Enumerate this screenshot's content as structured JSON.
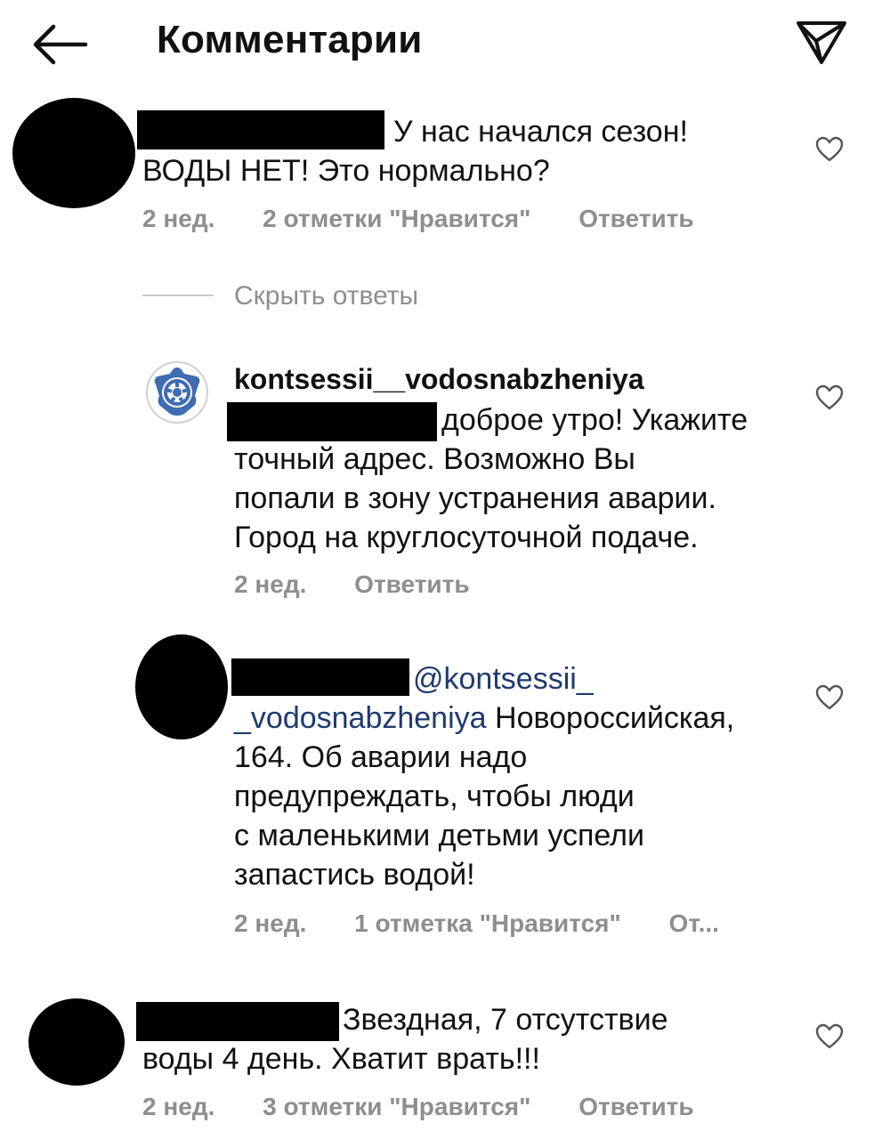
{
  "header": {
    "title": "Комментарии"
  },
  "comments": [
    {
      "text_line1": "У нас начался сезон!",
      "text_line2": "ВОДЫ НЕТ! Это нормально?",
      "time": "2 нед.",
      "likes": "2 отметки \"Нравится\"",
      "reply": "Ответить"
    },
    {
      "text_line1": "Звездная, 7 отсутствие",
      "text_line2": "воды 4 день. Хватит врать!!!",
      "time": "2 нед.",
      "likes": "3 отметки \"Нравится\"",
      "reply": "Ответить"
    }
  ],
  "hide_replies": "Скрыть ответы",
  "replies": [
    {
      "username": "kontsessii__vodosnabzheniya",
      "lines": [
        "доброе утро! Укажите",
        "точный адрес. Возможно Вы",
        "попали в зону устранения аварии.",
        "Город на круглосуточной подаче."
      ],
      "time": "2 нед.",
      "reply": "Ответить"
    },
    {
      "mention_line1": "@kontsessii_",
      "mention_line2": "_vodosnabzheniya",
      "line2_rest": " Новороссийская,",
      "lines": [
        "164. Об аварии надо",
        "предупреждать, чтобы люди",
        "с маленькими детьми успели",
        "запастись водой!"
      ],
      "time": "2 нед.",
      "likes": "1 отметка \"Нравится\"",
      "reply": "От..."
    }
  ],
  "icons": {
    "back": "arrow-left-icon",
    "send": "paper-plane-icon",
    "like": "heart-outline-icon",
    "org_logo": "valve-wheel-icon"
  },
  "colors": {
    "text": "#111111",
    "muted": "#8e8e8e",
    "mention": "#1e3a6e",
    "logo": "#3f6cb3"
  }
}
